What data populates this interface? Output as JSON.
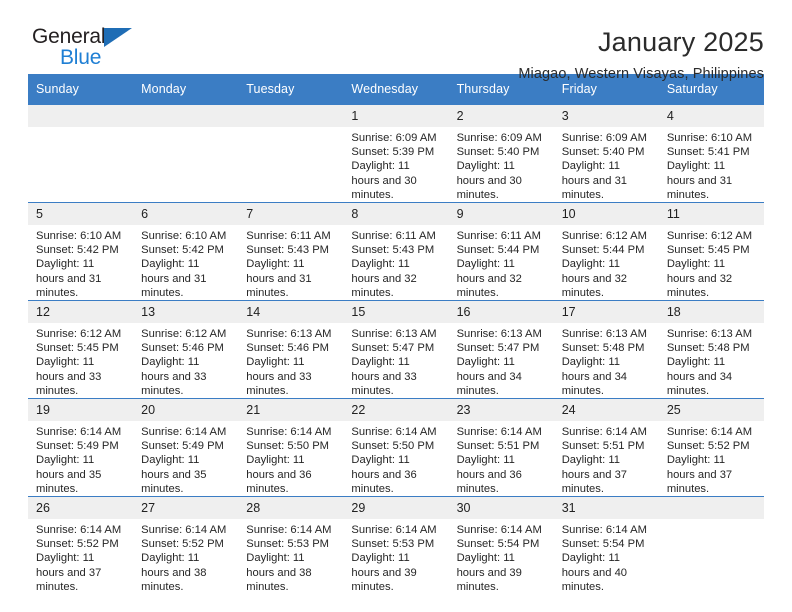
{
  "brand": {
    "name_part1": "General",
    "name_part2": "Blue",
    "accent_color": "#1f7fd4",
    "triangle_color": "#1f6db5"
  },
  "header": {
    "title": "January 2025",
    "subtitle": "Miagao, Western Visayas, Philippines",
    "header_bg_color": "#3b7dc4"
  },
  "weekdays": [
    "Sunday",
    "Monday",
    "Tuesday",
    "Wednesday",
    "Thursday",
    "Friday",
    "Saturday"
  ],
  "labels": {
    "sunrise": "Sunrise:",
    "sunset": "Sunset:",
    "daylight": "Daylight:"
  },
  "weeks": [
    [
      {
        "day": "",
        "empty": true
      },
      {
        "day": "",
        "empty": true
      },
      {
        "day": "",
        "empty": true
      },
      {
        "day": "1",
        "sunrise": "Sunrise: 6:09 AM",
        "sunset": "Sunset: 5:39 PM",
        "daylight": "Daylight: 11 hours and 30 minutes."
      },
      {
        "day": "2",
        "sunrise": "Sunrise: 6:09 AM",
        "sunset": "Sunset: 5:40 PM",
        "daylight": "Daylight: 11 hours and 30 minutes."
      },
      {
        "day": "3",
        "sunrise": "Sunrise: 6:09 AM",
        "sunset": "Sunset: 5:40 PM",
        "daylight": "Daylight: 11 hours and 31 minutes."
      },
      {
        "day": "4",
        "sunrise": "Sunrise: 6:10 AM",
        "sunset": "Sunset: 5:41 PM",
        "daylight": "Daylight: 11 hours and 31 minutes."
      }
    ],
    [
      {
        "day": "5",
        "sunrise": "Sunrise: 6:10 AM",
        "sunset": "Sunset: 5:42 PM",
        "daylight": "Daylight: 11 hours and 31 minutes."
      },
      {
        "day": "6",
        "sunrise": "Sunrise: 6:10 AM",
        "sunset": "Sunset: 5:42 PM",
        "daylight": "Daylight: 11 hours and 31 minutes."
      },
      {
        "day": "7",
        "sunrise": "Sunrise: 6:11 AM",
        "sunset": "Sunset: 5:43 PM",
        "daylight": "Daylight: 11 hours and 31 minutes."
      },
      {
        "day": "8",
        "sunrise": "Sunrise: 6:11 AM",
        "sunset": "Sunset: 5:43 PM",
        "daylight": "Daylight: 11 hours and 32 minutes."
      },
      {
        "day": "9",
        "sunrise": "Sunrise: 6:11 AM",
        "sunset": "Sunset: 5:44 PM",
        "daylight": "Daylight: 11 hours and 32 minutes."
      },
      {
        "day": "10",
        "sunrise": "Sunrise: 6:12 AM",
        "sunset": "Sunset: 5:44 PM",
        "daylight": "Daylight: 11 hours and 32 minutes."
      },
      {
        "day": "11",
        "sunrise": "Sunrise: 6:12 AM",
        "sunset": "Sunset: 5:45 PM",
        "daylight": "Daylight: 11 hours and 32 minutes."
      }
    ],
    [
      {
        "day": "12",
        "sunrise": "Sunrise: 6:12 AM",
        "sunset": "Sunset: 5:45 PM",
        "daylight": "Daylight: 11 hours and 33 minutes."
      },
      {
        "day": "13",
        "sunrise": "Sunrise: 6:12 AM",
        "sunset": "Sunset: 5:46 PM",
        "daylight": "Daylight: 11 hours and 33 minutes."
      },
      {
        "day": "14",
        "sunrise": "Sunrise: 6:13 AM",
        "sunset": "Sunset: 5:46 PM",
        "daylight": "Daylight: 11 hours and 33 minutes."
      },
      {
        "day": "15",
        "sunrise": "Sunrise: 6:13 AM",
        "sunset": "Sunset: 5:47 PM",
        "daylight": "Daylight: 11 hours and 33 minutes."
      },
      {
        "day": "16",
        "sunrise": "Sunrise: 6:13 AM",
        "sunset": "Sunset: 5:47 PM",
        "daylight": "Daylight: 11 hours and 34 minutes."
      },
      {
        "day": "17",
        "sunrise": "Sunrise: 6:13 AM",
        "sunset": "Sunset: 5:48 PM",
        "daylight": "Daylight: 11 hours and 34 minutes."
      },
      {
        "day": "18",
        "sunrise": "Sunrise: 6:13 AM",
        "sunset": "Sunset: 5:48 PM",
        "daylight": "Daylight: 11 hours and 34 minutes."
      }
    ],
    [
      {
        "day": "19",
        "sunrise": "Sunrise: 6:14 AM",
        "sunset": "Sunset: 5:49 PM",
        "daylight": "Daylight: 11 hours and 35 minutes."
      },
      {
        "day": "20",
        "sunrise": "Sunrise: 6:14 AM",
        "sunset": "Sunset: 5:49 PM",
        "daylight": "Daylight: 11 hours and 35 minutes."
      },
      {
        "day": "21",
        "sunrise": "Sunrise: 6:14 AM",
        "sunset": "Sunset: 5:50 PM",
        "daylight": "Daylight: 11 hours and 36 minutes."
      },
      {
        "day": "22",
        "sunrise": "Sunrise: 6:14 AM",
        "sunset": "Sunset: 5:50 PM",
        "daylight": "Daylight: 11 hours and 36 minutes."
      },
      {
        "day": "23",
        "sunrise": "Sunrise: 6:14 AM",
        "sunset": "Sunset: 5:51 PM",
        "daylight": "Daylight: 11 hours and 36 minutes."
      },
      {
        "day": "24",
        "sunrise": "Sunrise: 6:14 AM",
        "sunset": "Sunset: 5:51 PM",
        "daylight": "Daylight: 11 hours and 37 minutes."
      },
      {
        "day": "25",
        "sunrise": "Sunrise: 6:14 AM",
        "sunset": "Sunset: 5:52 PM",
        "daylight": "Daylight: 11 hours and 37 minutes."
      }
    ],
    [
      {
        "day": "26",
        "sunrise": "Sunrise: 6:14 AM",
        "sunset": "Sunset: 5:52 PM",
        "daylight": "Daylight: 11 hours and 37 minutes."
      },
      {
        "day": "27",
        "sunrise": "Sunrise: 6:14 AM",
        "sunset": "Sunset: 5:52 PM",
        "daylight": "Daylight: 11 hours and 38 minutes."
      },
      {
        "day": "28",
        "sunrise": "Sunrise: 6:14 AM",
        "sunset": "Sunset: 5:53 PM",
        "daylight": "Daylight: 11 hours and 38 minutes."
      },
      {
        "day": "29",
        "sunrise": "Sunrise: 6:14 AM",
        "sunset": "Sunset: 5:53 PM",
        "daylight": "Daylight: 11 hours and 39 minutes."
      },
      {
        "day": "30",
        "sunrise": "Sunrise: 6:14 AM",
        "sunset": "Sunset: 5:54 PM",
        "daylight": "Daylight: 11 hours and 39 minutes."
      },
      {
        "day": "31",
        "sunrise": "Sunrise: 6:14 AM",
        "sunset": "Sunset: 5:54 PM",
        "daylight": "Daylight: 11 hours and 40 minutes."
      },
      {
        "day": "",
        "empty": true
      }
    ]
  ]
}
